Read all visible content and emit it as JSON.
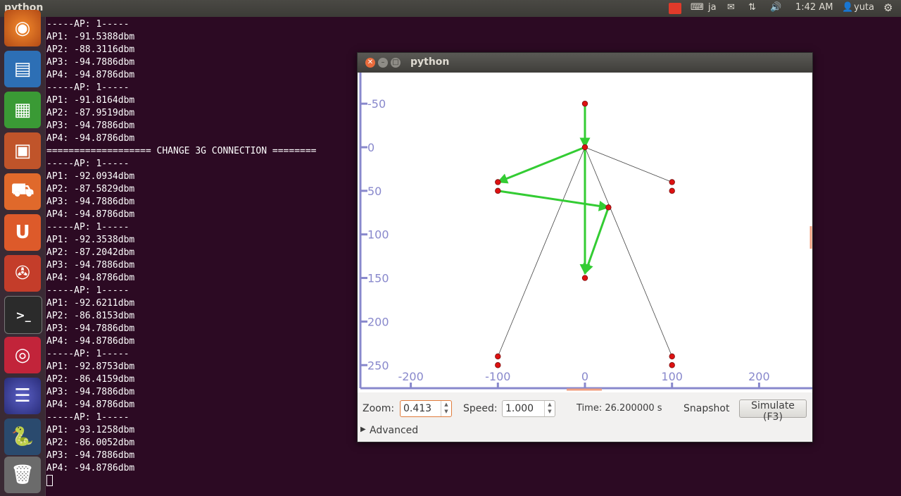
{
  "panel": {
    "app_title": "python",
    "keyboard_layout": "ja",
    "clock": "1:42 AM",
    "user": "yuta"
  },
  "launcher": {
    "items": [
      "firefox",
      "writer",
      "calc",
      "impress",
      "software-center",
      "ubuntu-one",
      "system-settings",
      "terminal",
      "app-red",
      "eclipse",
      "python",
      "trash"
    ]
  },
  "terminal": {
    "lines": [
      "-----AP: 1-----",
      "AP1: -91.5388dbm",
      "AP2: -88.3116dbm",
      "AP3: -94.7886dbm",
      "AP4: -94.8786dbm",
      "-----AP: 1-----",
      "AP1: -91.8164dbm",
      "AP2: -87.9519dbm",
      "AP3: -94.7886dbm",
      "AP4: -94.8786dbm",
      "=================== CHANGE 3G CONNECTION ========",
      "-----AP: 1-----",
      "AP1: -92.0934dbm",
      "AP2: -87.5829dbm",
      "AP3: -94.7886dbm",
      "AP4: -94.8786dbm",
      "-----AP: 1-----",
      "AP1: -92.3538dbm",
      "AP2: -87.2042dbm",
      "AP3: -94.7886dbm",
      "AP4: -94.8786dbm",
      "-----AP: 1-----",
      "AP1: -92.6211dbm",
      "AP2: -86.8153dbm",
      "AP3: -94.7886dbm",
      "AP4: -94.8786dbm",
      "-----AP: 1-----",
      "AP1: -92.8753dbm",
      "AP2: -86.4159dbm",
      "AP3: -94.7886dbm",
      "AP4: -94.8786dbm",
      "-----AP: 1-----",
      "AP1: -93.1258dbm",
      "AP2: -86.0052dbm",
      "AP3: -94.7886dbm",
      "AP4: -94.8786dbm"
    ]
  },
  "window": {
    "title": "python",
    "controls": {
      "zoom_label": "Zoom:",
      "zoom_value": "0.413",
      "speed_label": "Speed:",
      "speed_value": "1.000",
      "time_text": "Time: 26.200000 s",
      "snapshot_label": "Snapshot",
      "simulate_label": "Simulate (F3)",
      "advanced_label": "Advanced"
    }
  },
  "chart_data": {
    "type": "scatter",
    "x_ticks": [
      "-200",
      "-100",
      "0",
      "100",
      "200"
    ],
    "y_ticks": [
      "-50",
      "0",
      "50",
      "100",
      "150",
      "200",
      "250"
    ],
    "nodes": [
      {
        "x": 0,
        "y": -50
      },
      {
        "x": 0,
        "y": 0
      },
      {
        "x": -100,
        "y": 40
      },
      {
        "x": -100,
        "y": 50
      },
      {
        "x": 27,
        "y": 69
      },
      {
        "x": 0,
        "y": 150
      },
      {
        "x": 100,
        "y": 40
      },
      {
        "x": 100,
        "y": 50
      },
      {
        "x": -100,
        "y": 240
      },
      {
        "x": -100,
        "y": 250
      },
      {
        "x": 100,
        "y": 240
      },
      {
        "x": 100,
        "y": 250
      }
    ],
    "links": [
      [
        0,
        0,
        100,
        40
      ],
      [
        0,
        0,
        -100,
        240
      ],
      [
        0,
        0,
        100,
        240
      ]
    ],
    "moves": [
      [
        0,
        -50,
        0,
        0
      ],
      [
        0,
        0,
        -100,
        40
      ],
      [
        -100,
        50,
        27,
        69
      ],
      [
        27,
        69,
        0,
        145
      ],
      [
        0,
        0,
        0,
        145
      ]
    ],
    "colors": {
      "node": "#dd1111",
      "link": "#444444",
      "move": "#33cc33",
      "axis": "#8888cc"
    }
  }
}
